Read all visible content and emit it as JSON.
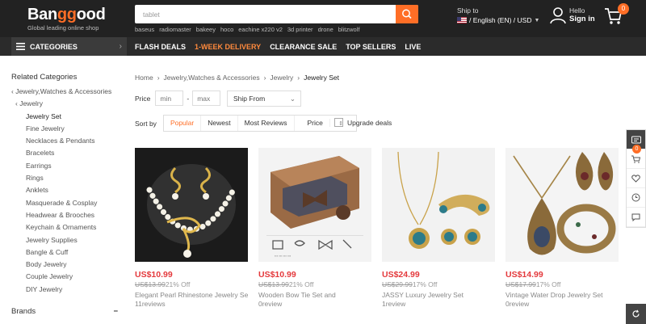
{
  "header": {
    "logo_a": "Ban",
    "logo_g": "gg",
    "logo_b": "ood",
    "logo_sub": "Global leading online shop",
    "search_value": "tablet",
    "hot_words": [
      "baseus",
      "radiomaster",
      "bakeey",
      "hoco",
      "eachine x220 v2",
      "3d printer",
      "drone",
      "blitzwolf"
    ],
    "ship_to_label": "Ship to",
    "ship_to_value": "/ English (EN) / USD",
    "hello": "Hello",
    "sign_in": "Sign in",
    "cart_count": "0"
  },
  "nav": {
    "categories": "CATEGORIES",
    "links": [
      "FLASH DEALS",
      "1-WEEK DELIVERY",
      "CLEARANCE SALE",
      "TOP SELLERS",
      "LIVE"
    ]
  },
  "sidebar": {
    "title": "Related Categories",
    "parents": [
      "Jewelry,Watches & Accessories",
      "Jewelry"
    ],
    "items": [
      "Jewelry Set",
      "Fine Jewelry",
      "Necklaces & Pendants",
      "Bracelets",
      "Earrings",
      "Rings",
      "Anklets",
      "Masquerade & Cosplay",
      "Headwear & Brooches",
      "Keychain & Ornaments",
      "Jewelry Supplies",
      "Bangle & Cuff",
      "Body Jewelry",
      "Couple Jewelry",
      "DIY Jewelry"
    ],
    "brands": "Brands"
  },
  "breadcrumb": [
    "Home",
    "Jewelry,Watches & Accessories",
    "Jewelry",
    "Jewelry Set"
  ],
  "filters": {
    "price_label": "Price",
    "min_placeholder": "min",
    "max_placeholder": "max",
    "ship_from": "Ship From",
    "sort_label": "Sort by",
    "sort_options": [
      "Popular",
      "Newest",
      "Most Reviews",
      "Price"
    ],
    "upgrade": "Upgrade deals"
  },
  "products": [
    {
      "price": "US$10.99",
      "old": "US$13.99",
      "off": "21% Off",
      "name": "Elegant Pearl Rhinestone Jewelry Set",
      "reviews": "11reviews"
    },
    {
      "price": "US$10.99",
      "old": "US$13.99",
      "off": "21% Off",
      "name": "Wooden Bow Tie Set and",
      "reviews": "0review"
    },
    {
      "price": "US$24.99",
      "old": "US$29.99",
      "off": "17% Off",
      "name": "JASSY Luxury Jewelry Set",
      "reviews": "1review"
    },
    {
      "price": "US$14.99",
      "old": "US$17.99",
      "off": "17% Off",
      "name": "Vintage Water Drop Jewelry Set",
      "reviews": "0review"
    }
  ],
  "rail": {
    "cart_count": "0"
  },
  "colors": {
    "accent": "#ff6e26",
    "price": "#e4393c",
    "header": "#222222"
  }
}
